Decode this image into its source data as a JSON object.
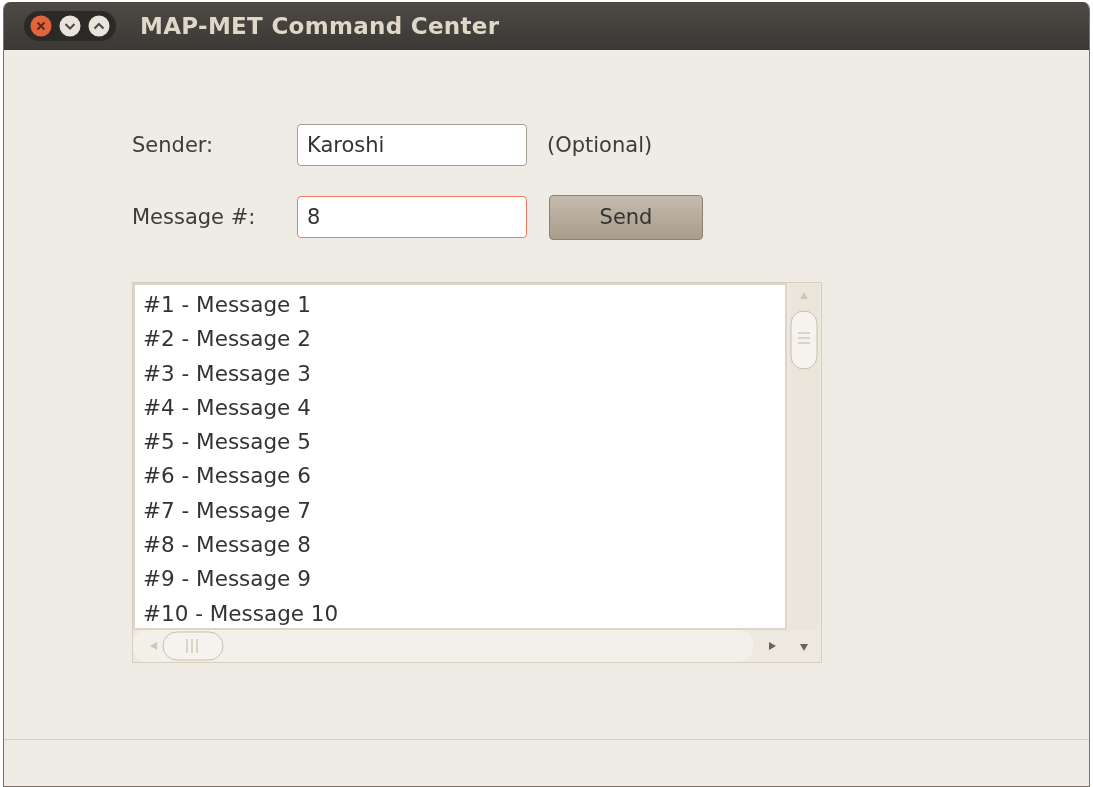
{
  "window": {
    "title": "MAP-MET Command Center"
  },
  "form": {
    "fields": [
      {
        "label": "Sender:",
        "value": "Karoshi",
        "focused": false,
        "note": "(Optional)"
      },
      {
        "label": "Message #:",
        "value": "8",
        "focused": true,
        "button": "Send"
      }
    ]
  },
  "messages": [
    "#1 - Message 1",
    "#2 - Message 2",
    "#3 - Message 3",
    "#4 - Message 4",
    "#5 - Message 5",
    "#6 - Message 6",
    "#7 - Message 7",
    "#8 - Message 8",
    "#9 - Message 9",
    "#10 - Message 10"
  ]
}
